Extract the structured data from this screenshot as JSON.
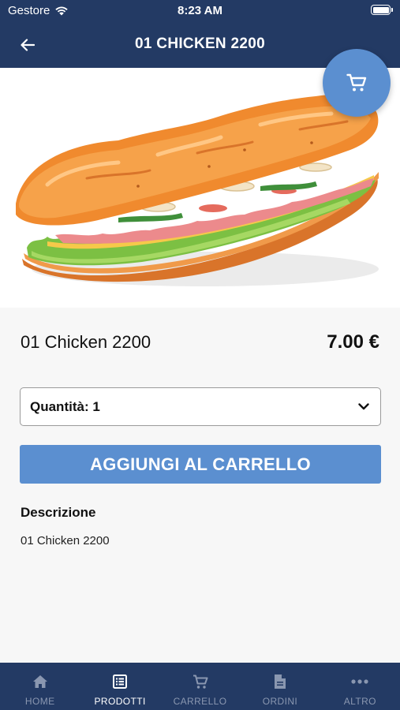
{
  "status_bar": {
    "carrier": "Gestore",
    "time": "8:23 AM"
  },
  "navbar": {
    "title": "01 CHICKEN 2200",
    "back_icon": "arrow-left-icon"
  },
  "hero": {
    "image": "sandwich-baguette-illustration",
    "cart_icon": "shopping-cart-icon"
  },
  "product": {
    "name": "01 Chicken 2200",
    "price": "7.00 €"
  },
  "quantity": {
    "label": "Quantità: 1",
    "icon": "chevron-down-icon"
  },
  "add_button": {
    "label": "AGGIUNGI AL CARRELLO"
  },
  "description": {
    "title": "Descrizione",
    "text": "01 Chicken 2200"
  },
  "tabbar": {
    "tabs": [
      {
        "label": "HOME",
        "icon": "home-icon",
        "active": false
      },
      {
        "label": "PRODOTTI",
        "icon": "list-icon",
        "active": true
      },
      {
        "label": "CARRELLO",
        "icon": "cart-icon",
        "active": false
      },
      {
        "label": "ORDINI",
        "icon": "document-icon",
        "active": false
      },
      {
        "label": "ALTRO",
        "icon": "more-icon",
        "active": false
      }
    ]
  },
  "colors": {
    "header_bg": "#233a64",
    "accent": "#5b8fd0",
    "page_bg": "#f7f7f7"
  }
}
